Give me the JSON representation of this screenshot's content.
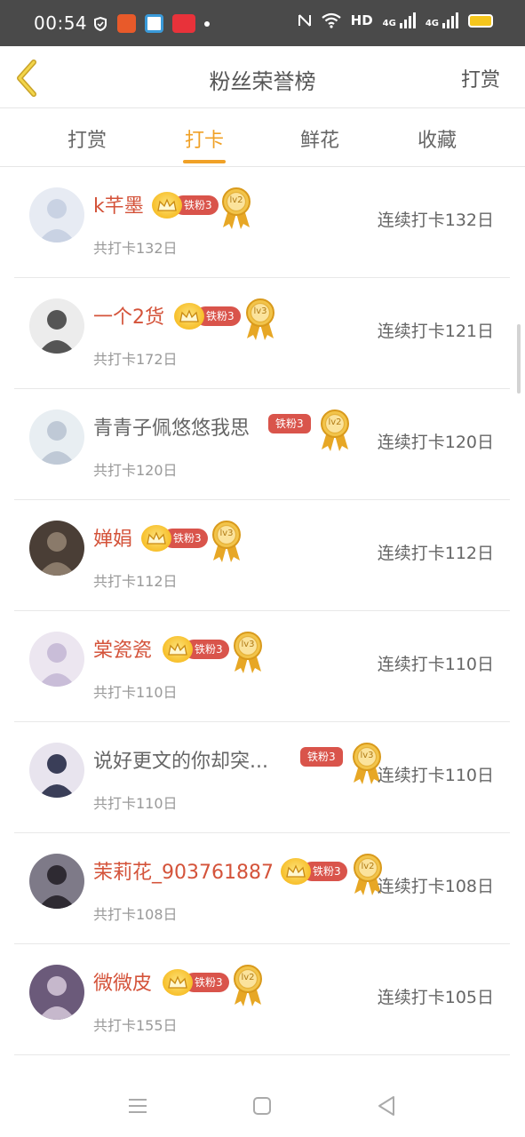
{
  "status_bar": {
    "time": "00:54",
    "network": "HD",
    "signal1": "4G",
    "signal2": "4G"
  },
  "header": {
    "title": "粉丝荣誉榜",
    "right_action": "打赏"
  },
  "tabs": [
    {
      "label": "打赏",
      "active": false
    },
    {
      "label": "打卡",
      "active": true
    },
    {
      "label": "鲜花",
      "active": false
    },
    {
      "label": "收藏",
      "active": false
    }
  ],
  "fans": [
    {
      "name": "k芊墨",
      "badge": "铁粉3",
      "level": "lv2",
      "total": "共打卡132日",
      "streak": "连续打卡132日",
      "crown": true
    },
    {
      "name": "一个2货",
      "badge": "铁粉3",
      "level": "lv3",
      "total": "共打卡172日",
      "streak": "连续打卡121日",
      "crown": true
    },
    {
      "name": "青青子佩悠悠我思",
      "badge": "铁粉3",
      "level": "lv2",
      "total": "共打卡120日",
      "streak": "连续打卡120日",
      "crown": false
    },
    {
      "name": "婵娟",
      "badge": "铁粉3",
      "level": "lv3",
      "total": "共打卡112日",
      "streak": "连续打卡112日",
      "crown": true
    },
    {
      "name": "棠瓷瓷",
      "badge": "铁粉3",
      "level": "lv3",
      "total": "共打卡110日",
      "streak": "连续打卡110日",
      "crown": true
    },
    {
      "name": "说好更文的你却突...",
      "badge": "铁粉3",
      "level": "lv3",
      "total": "共打卡110日",
      "streak": "连续打卡110日",
      "crown": false
    },
    {
      "name": "茉莉花_903761887",
      "badge": "铁粉3",
      "level": "lv2",
      "total": "共打卡108日",
      "streak": "连续打卡108日",
      "crown": true
    },
    {
      "name": "微微皮",
      "badge": "铁粉3",
      "level": "lv2",
      "total": "共打卡155日",
      "streak": "连续打卡105日",
      "crown": true
    }
  ],
  "colors": {
    "accent": "#f0a127",
    "name_red": "#d4533a",
    "badge_red": "#d9544b",
    "status_bar": "#4a4a4a"
  }
}
